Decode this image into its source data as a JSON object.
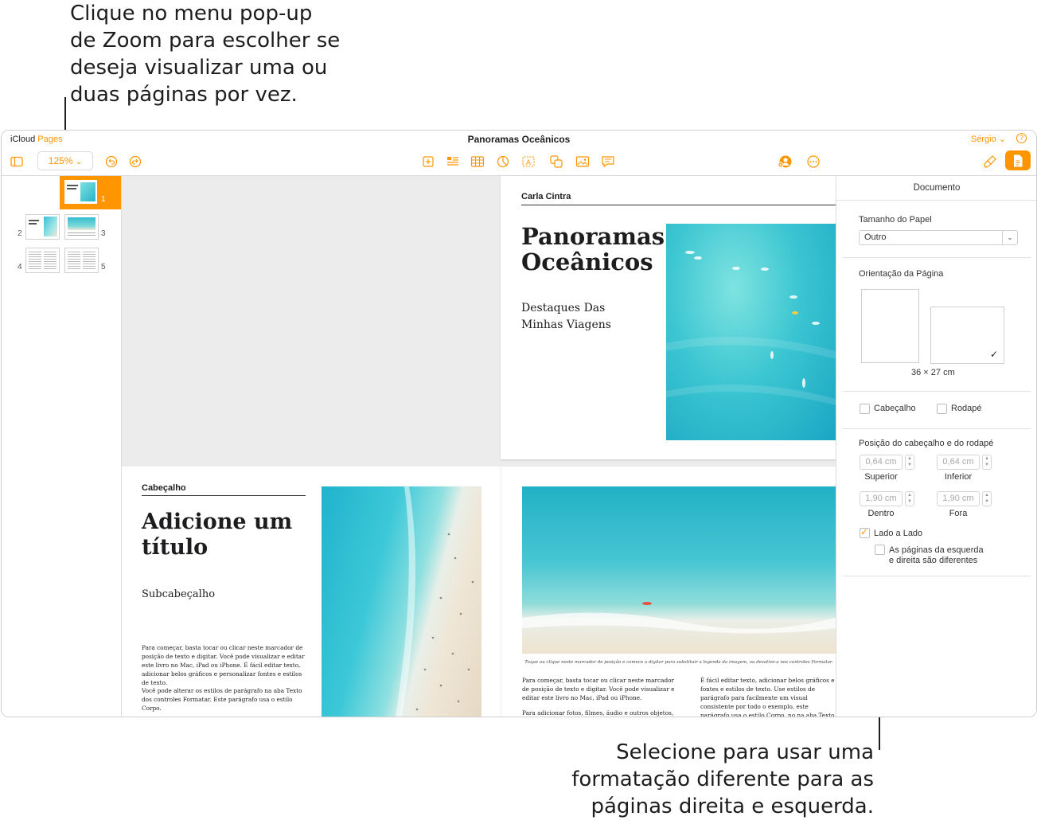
{
  "callouts": {
    "top": "Clique no menu pop-up\nde Zoom para escolher se\ndeseja visualizar uma ou\nduas páginas por vez.",
    "bottom": "Selecione para usar uma\nformatação diferente para as\npáginas direita e esquerda."
  },
  "titlebar": {
    "brand_icloud": "iCloud",
    "brand_pages": "Pages",
    "document_title": "Panoramas Oceânicos",
    "user": "Sérgio",
    "help_glyph": "?"
  },
  "toolbar": {
    "zoom_label": "125%",
    "icons": {
      "sidebar": "sidebar-icon",
      "undo": "undo-icon",
      "redo": "redo-icon",
      "add_page": "add-page-icon",
      "text_box": "text-icon",
      "table": "table-icon",
      "chart": "chart-icon",
      "shape_text": "shape-text-icon",
      "shape": "shape-icon",
      "media": "media-icon",
      "comment": "comment-icon",
      "collaborate": "collaborate-icon",
      "more": "more-icon",
      "format": "format-brush-icon",
      "document": "document-icon"
    }
  },
  "thumbnails": {
    "page_numbers": [
      "1",
      "2",
      "3",
      "4",
      "5"
    ]
  },
  "pages": {
    "cover": {
      "author": "Carla Cintra",
      "title_line1": "Panoramas",
      "title_line2": "Oceânicos",
      "subtitle_line1": "Destaques Das",
      "subtitle_line2": "Minhas Viagens"
    },
    "page2": {
      "header": "Cabeçalho",
      "title_line1": "Adicione um",
      "title_line2": "título",
      "subheading": "Subcabeçalho",
      "body1": "Para começar, basta tocar ou clicar neste marcador de posição de texto e digitar. Você pode visualizar e editar este livro no Mac, iPad ou iPhone. É fácil editar texto, adicionar belos gráficos e personalizar fontes e estilos de texto.",
      "body2": "Você pode alterar os estilos de parágrafo na aba Texto dos controles Formatar. Este parágrafo usa o estilo Corpo."
    },
    "page3": {
      "caption": "Toque ou clique neste marcador de posição e comece a digitar para substituir a legenda da imagem, ou desative-a nos controles Formatar.",
      "col1": "Para começar, basta tocar ou clicar neste marcador de posição de texto e digitar. Você pode visualizar e editar este livro no Mac, iPad ou iPhone.",
      "col1b": "Para adicionar fotos, filmes, áudio e outros objetos, toque ou",
      "col2": "É fácil editar texto, adicionar belos gráficos e fontes e estilos de texto. Use estilos de parágrafo para facilmente um visual consistente por todo o exemplo, este parágrafo usa o estilo Corpo. no na aba Texto dos controles Formatar."
    }
  },
  "inspector": {
    "header": "Documento",
    "paper_size_label": "Tamanho do Papel",
    "paper_size_value": "Outro",
    "orientation_label": "Orientação da Página",
    "dimensions": "36 × 27 cm",
    "check_glyph": "✓",
    "header_checkbox": "Cabeçalho",
    "footer_checkbox": "Rodapé",
    "position_label": "Posição do cabeçalho e do rodapé",
    "top_value": "0,64 cm",
    "top_label": "Superior",
    "bottom_value": "0,64 cm",
    "bottom_label": "Inferior",
    "inside_value": "1,90 cm",
    "inside_label": "Dentro",
    "outside_value": "1,90 cm",
    "outside_label": "Fora",
    "facing_pages": "Lado a Lado",
    "different_lr_line1": "As páginas da esquerda",
    "different_lr_line2": "e direita são diferentes"
  },
  "colors": {
    "accent": "#ff9500",
    "water_light": "#5fd3d6",
    "water_deep": "#1ea8c5",
    "sand": "#efe6d6"
  }
}
